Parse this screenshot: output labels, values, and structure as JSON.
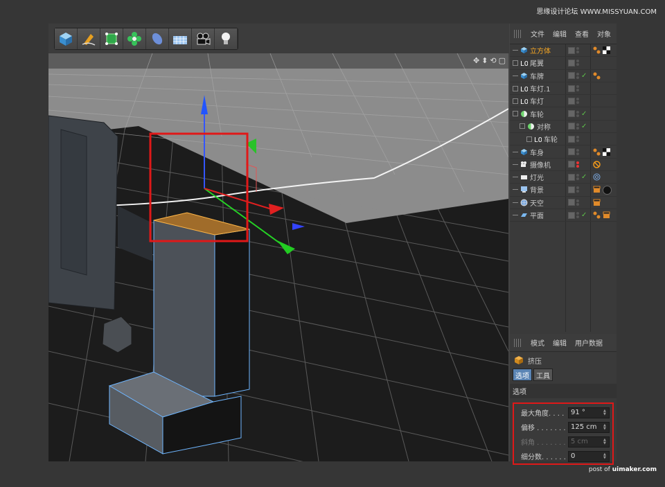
{
  "watermarks": {
    "top": "思缘设计论坛 WWW.MISSYUAN.COM",
    "bottom_prefix": "post of",
    "bottom_site": "uimaker.com"
  },
  "toolbar": {
    "tools": [
      "cube-icon",
      "pen-icon",
      "select-cube-icon",
      "gear-flower-icon",
      "deformer-icon",
      "floor-grid-icon",
      "camera-icon",
      "light-bulb-icon"
    ]
  },
  "viewport": {
    "nav_icons": [
      "✥",
      "⬍",
      "⟲",
      "▢"
    ],
    "highlight_color": "#e01818"
  },
  "object_manager": {
    "menu": [
      "文件",
      "编辑",
      "查看",
      "对象"
    ],
    "objects": [
      {
        "name": "立方体",
        "indent": 0,
        "icon": "cube-icon",
        "selected": true,
        "check": false,
        "tags": [
          "material-dots-icon",
          "checker-tag-icon"
        ]
      },
      {
        "name": "尾翼",
        "indent": 0,
        "icon": "null-object-icon",
        "expand": true,
        "check": false,
        "tags": []
      },
      {
        "name": "车牌",
        "indent": 0,
        "icon": "cube-icon",
        "check": true,
        "tags": [
          "material-dots-icon"
        ]
      },
      {
        "name": "车灯.1",
        "indent": 0,
        "icon": "null-object-icon",
        "expand": true,
        "check": false,
        "tags": []
      },
      {
        "name": "车灯",
        "indent": 0,
        "icon": "null-object-icon",
        "expand": true,
        "check": false,
        "tags": []
      },
      {
        "name": "车轮",
        "indent": 0,
        "icon": "sphere-icon",
        "expand": true,
        "check": true,
        "tags": []
      },
      {
        "name": "对称",
        "indent": 1,
        "icon": "sphere-icon",
        "expand": true,
        "check": true,
        "tags": []
      },
      {
        "name": "车轮",
        "indent": 2,
        "icon": "null-object-icon",
        "expand": true,
        "check": false,
        "tags": []
      },
      {
        "name": "车身",
        "indent": 0,
        "icon": "cube-icon",
        "check": false,
        "tags": [
          "material-dots-icon",
          "checker-tag-icon"
        ]
      },
      {
        "name": "摄像机",
        "indent": 0,
        "icon": "camera-icon",
        "check": false,
        "red": true,
        "tags": [
          "no-entry-tag-icon"
        ]
      },
      {
        "name": "灯光",
        "indent": 0,
        "icon": "light-icon",
        "check": true,
        "tags": [
          "target-tag-icon"
        ]
      },
      {
        "name": "背景",
        "indent": 0,
        "icon": "background-icon",
        "check": false,
        "tags": [
          "clapper-tag-icon",
          "black-sphere-icon"
        ]
      },
      {
        "name": "天空",
        "indent": 0,
        "icon": "sky-icon",
        "check": false,
        "tags": [
          "clapper-tag-icon"
        ]
      },
      {
        "name": "平面",
        "indent": 0,
        "icon": "plane-icon",
        "check": true,
        "tags": [
          "material-dots-icon",
          "clapper-tag-icon"
        ]
      }
    ]
  },
  "attributes": {
    "menu": [
      "模式",
      "编辑",
      "用户数据"
    ],
    "title": "挤压",
    "tabs": [
      "选项",
      "工具"
    ],
    "section": "选项",
    "fields": [
      {
        "label": "最大角度. . . .",
        "value": "91 °",
        "enabled": true
      },
      {
        "label": "偏移 . . . . . . .",
        "value": "125 cm",
        "enabled": true
      },
      {
        "label": "斜角 . . . . . . .",
        "value": "5 cm",
        "enabled": false
      },
      {
        "label": "细分数. . . . . .",
        "value": "0",
        "enabled": true
      }
    ]
  }
}
